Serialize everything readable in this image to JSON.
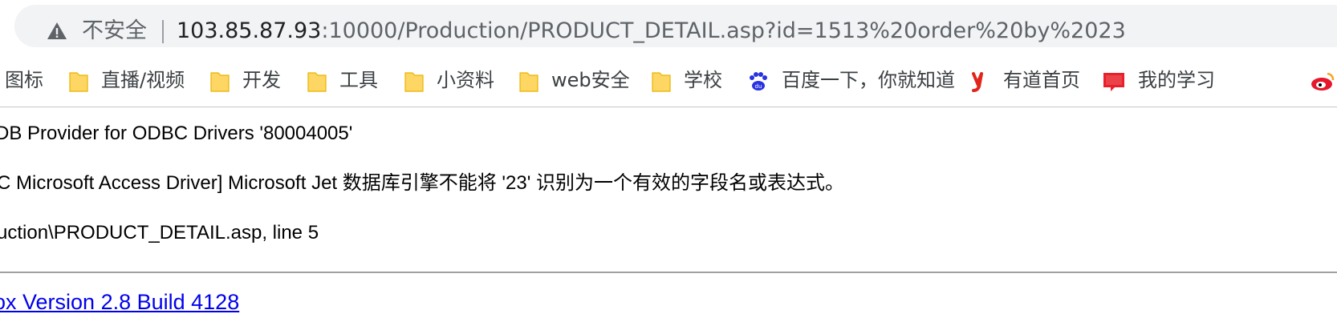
{
  "browser": {
    "security_label": "不安全",
    "url_host": "103.85.87.93",
    "url_rest": ":10000/Production/PRODUCT_DETAIL.asp?id=1513%20order%20by%2023"
  },
  "bookmarks": [
    {
      "label": "图标",
      "icon": "none"
    },
    {
      "label": "直播/视频",
      "icon": "folder-icon"
    },
    {
      "label": "开发",
      "icon": "folder-icon"
    },
    {
      "label": "工具",
      "icon": "folder-icon"
    },
    {
      "label": "小资料",
      "icon": "folder-icon"
    },
    {
      "label": "web安全",
      "icon": "folder-icon"
    },
    {
      "label": "学校",
      "icon": "folder-icon"
    },
    {
      "label": "百度一下，你就知道",
      "icon": "baidu-icon"
    },
    {
      "label": "有道首页",
      "icon": "youdao-icon"
    },
    {
      "label": "我的学习",
      "icon": "red-book-icon"
    },
    {
      "label": "",
      "icon": "weibo-icon"
    }
  ],
  "error": {
    "line1": "DB Provider for ODBC Drivers '80004005'",
    "line2": "C Microsoft Access Driver] Microsoft Jet 数据库引擎不能将 '23' 识别为一个有效的字段名或表达式。",
    "line3": "uction\\PRODUCT_DETAIL.asp, line 5"
  },
  "footer": {
    "version_link": "ox Version 2.8 Build 4128"
  },
  "colors": {
    "link": "#0000ee",
    "folder": "#fdd663",
    "omnibox_bg": "#f1f3f4"
  }
}
